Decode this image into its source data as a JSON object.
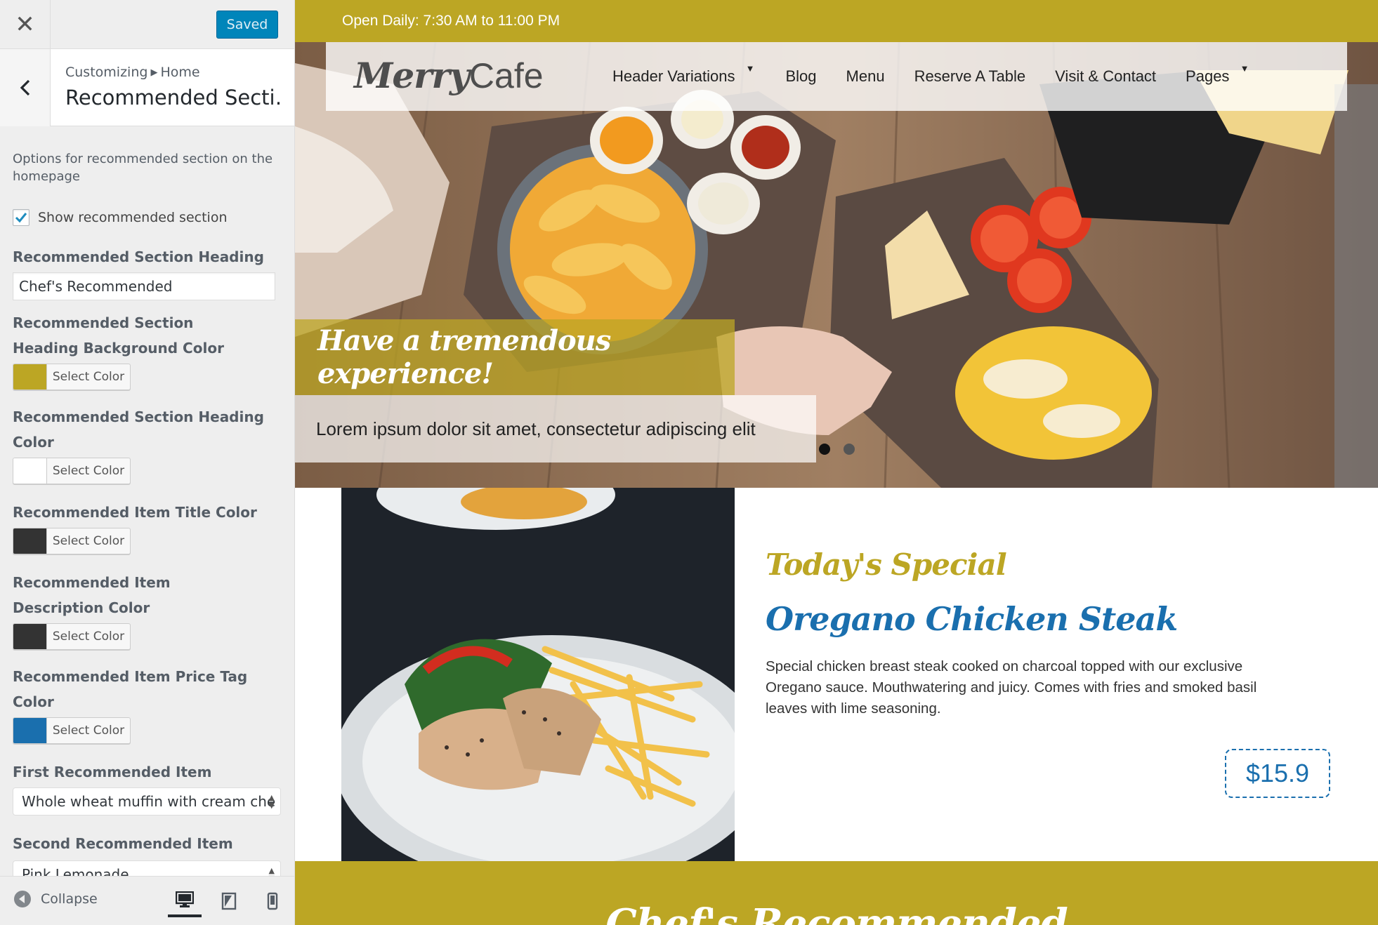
{
  "customizer": {
    "saved_label": "Saved",
    "breadcrumb": {
      "root": "Customizing",
      "current": "Home"
    },
    "section_title": "Recommended Secti…",
    "description": "Options for recommended section on the homepage",
    "show_section": {
      "label": "Show recommended section",
      "checked": true
    },
    "heading_label": "Recommended Section Heading",
    "heading_value": "Chef's Recommended",
    "color_controls": [
      {
        "label": "Recommended Section Heading Background Color",
        "color": "#bca624",
        "button": "Select Color"
      },
      {
        "label": "Recommended Section Heading Color",
        "color": "#ffffff",
        "button": "Select Color"
      },
      {
        "label": "Recommended Item Title Color",
        "color": "#333333",
        "button": "Select Color"
      },
      {
        "label": "Recommended Item Description Color",
        "color": "#333333",
        "button": "Select Color"
      },
      {
        "label": "Recommended Item Price Tag Color",
        "color": "#1a6fae",
        "button": "Select Color"
      }
    ],
    "first_item": {
      "label": "First Recommended Item",
      "value": "Whole wheat muffin with cream che"
    },
    "second_item": {
      "label": "Second Recommended Item",
      "value": "Pink Lemonade"
    },
    "footer": {
      "collapse_label": "Collapse",
      "active_device": "desktop"
    }
  },
  "site": {
    "topbar_text": "Open Daily: 7:30 AM to 11:00 PM",
    "logo": {
      "part1": "Merry",
      "part2": "Cafe"
    },
    "nav": [
      {
        "label": "Header Variations",
        "dropdown": true
      },
      {
        "label": "Blog",
        "dropdown": false
      },
      {
        "label": "Menu",
        "dropdown": false
      },
      {
        "label": "Reserve A Table",
        "dropdown": false
      },
      {
        "label": "Visit & Contact",
        "dropdown": false
      },
      {
        "label": "Pages",
        "dropdown": true
      }
    ],
    "slider": {
      "title": "Have a tremendous experience!",
      "subtitle": "Lorem ipsum dolor sit amet, consectetur adipiscing elit",
      "slides": 2,
      "active_slide": 1
    },
    "special": {
      "kicker": "Today's Special",
      "name": "Oregano Chicken Steak",
      "description": "Special chicken breast steak cooked on charcoal topped with our exclusive Oregano sauce. Mouthwatering and juicy. Comes with fries and smoked basil leaves with lime seasoning.",
      "price": "$15.9"
    },
    "recommended_heading": "Chef's Recommended",
    "colors": {
      "accent": "#bca624",
      "price": "#1a6fae",
      "wp_blue": "#0085ba"
    }
  }
}
